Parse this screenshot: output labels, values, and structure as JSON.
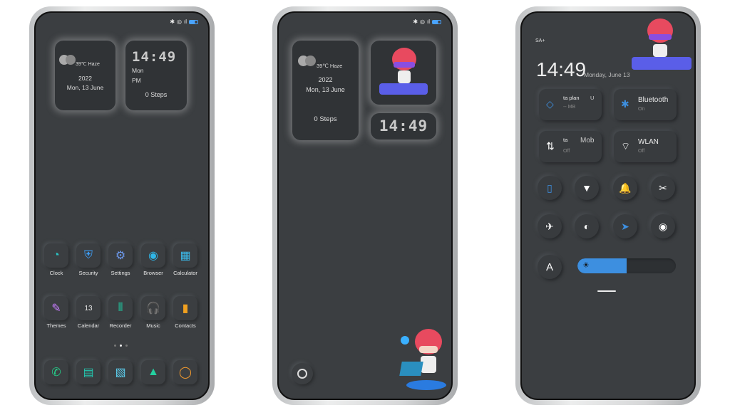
{
  "status": {
    "icons": [
      "bluetooth-icon",
      "nfc-icon",
      "signal-icon",
      "battery-icon"
    ]
  },
  "phone1": {
    "weather": "39℃ Haze",
    "year": "2022",
    "date": "Mon, 13 June",
    "time": "14:49",
    "day": "Mon",
    "ampm": "PM",
    "steps": "0 Steps",
    "apps": [
      {
        "label": "Clock",
        "icon": "clock-icon",
        "glyph": "◔",
        "color": "#2ac3c3"
      },
      {
        "label": "Security",
        "icon": "shield-icon",
        "glyph": "⛨",
        "color": "#3d9df5"
      },
      {
        "label": "Settings",
        "icon": "gear-icon",
        "glyph": "⚙",
        "color": "#6e9cf2"
      },
      {
        "label": "Browser",
        "icon": "compass-icon",
        "glyph": "◉",
        "color": "#2fb6e8"
      },
      {
        "label": "Calculator",
        "icon": "calculator-icon",
        "glyph": "▦",
        "color": "#3bb8e8"
      },
      {
        "label": "Themes",
        "icon": "brush-icon",
        "glyph": "✎",
        "color": "#c77dff"
      },
      {
        "label": "Calendar",
        "icon": "calendar-icon",
        "glyph": "13",
        "color": "#e5e5e5"
      },
      {
        "label": "Recorder",
        "icon": "waveform-icon",
        "glyph": "⦀",
        "color": "#1fc8a0"
      },
      {
        "label": "Music",
        "icon": "headphones-icon",
        "glyph": "🎧",
        "color": "#3aa8d8"
      },
      {
        "label": "Contacts",
        "icon": "contacts-icon",
        "glyph": "▮",
        "color": "#f0a020"
      }
    ],
    "dock": [
      {
        "icon": "phone-icon",
        "glyph": "✆",
        "color": "#24d08a"
      },
      {
        "icon": "message-icon",
        "glyph": "▤",
        "color": "#24c8b0"
      },
      {
        "icon": "notes-icon",
        "glyph": "▧",
        "color": "#5cd0f0"
      },
      {
        "icon": "gallery-icon",
        "glyph": "▲",
        "color": "#24d0a0"
      },
      {
        "icon": "camera-icon",
        "glyph": "◯",
        "color": "#f29a2e"
      }
    ]
  },
  "phone2": {
    "weather": "39℃ Haze",
    "year": "2022",
    "date": "Mon, 13 June",
    "steps": "0 Steps",
    "time": "14:49"
  },
  "phone3": {
    "carrier": "SA+",
    "time": "14:49",
    "date": "Monday, June 13",
    "tiles": [
      {
        "title": "ta plan",
        "extra": "U",
        "sub": "-- MB",
        "icon": "drop-icon",
        "glyph": "💧"
      },
      {
        "title": "Bluetooth",
        "sub": "On",
        "icon": "bluetooth-icon",
        "glyph": "✱"
      },
      {
        "title": "ta",
        "extra": "Mob",
        "sub": "Off",
        "icon": "data-arrows-icon",
        "glyph": "⇅"
      },
      {
        "title": "WLAN",
        "sub": "Off",
        "icon": "wifi-icon",
        "glyph": "⌔"
      }
    ],
    "toggles": [
      {
        "icon": "vibrate-icon",
        "glyph": "▯",
        "active": true
      },
      {
        "icon": "flashlight-icon",
        "glyph": "▼",
        "active": false
      },
      {
        "icon": "bell-icon",
        "glyph": "🔔",
        "active": false
      },
      {
        "icon": "screenshot-icon",
        "glyph": "✂",
        "active": false
      },
      {
        "icon": "airplane-icon",
        "glyph": "✈",
        "active": false
      },
      {
        "icon": "contrast-icon",
        "glyph": "◐",
        "active": false
      },
      {
        "icon": "location-icon",
        "glyph": "➤",
        "active": true
      },
      {
        "icon": "eye-icon",
        "glyph": "◉",
        "active": false
      }
    ],
    "auto_brightness": "A",
    "brightness": 0.5,
    "accent": "#3d8fe0"
  }
}
